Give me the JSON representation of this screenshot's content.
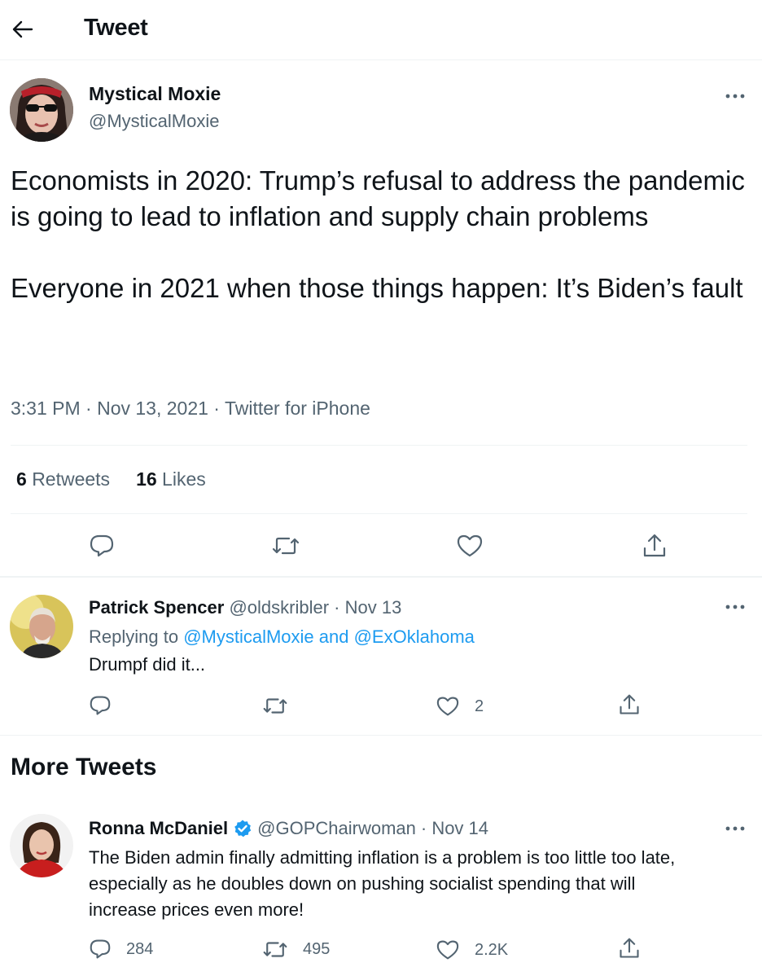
{
  "header": {
    "title": "Tweet"
  },
  "main_tweet": {
    "author_name": "Mystical Moxie",
    "author_handle": "@MysticalMoxie",
    "text": "Economists in 2020: Trump’s refusal to address the pandemic is going to lead to inflation and supply chain problems\n\nEveryone in 2021 when those things happen: It’s Biden’s fault",
    "timestamp": "3:31 PM · Nov 13, 2021 · Twitter for iPhone",
    "retweets_count": "6",
    "retweets_label": "Retweets",
    "likes_count": "16",
    "likes_label": "Likes"
  },
  "reply": {
    "author_name": "Patrick Spencer",
    "author_handle": "@oldskribler",
    "date": "· Nov 13",
    "replying_prefix": "Replying to",
    "replying_to": "@MysticalMoxie and @ExOklahoma",
    "text": "Drumpf did it...",
    "likes": "2"
  },
  "more_tweets": {
    "title": "More Tweets",
    "items": [
      {
        "author_name": "Ronna McDaniel",
        "author_handle": "@GOPChairwoman",
        "date": "· Nov 14",
        "text": "The Biden admin finally admitting inflation is a problem is too little too late,\nespecially as he doubles down on pushing socialist spending that will\nincrease prices even more!",
        "replies": "284",
        "retweets": "495",
        "likes": "2.2K"
      }
    ]
  },
  "colors": {
    "secondary_text": "#536471",
    "link": "#1d9bf0",
    "verified": "#1d9bf0",
    "divider": "#eff3f4"
  }
}
